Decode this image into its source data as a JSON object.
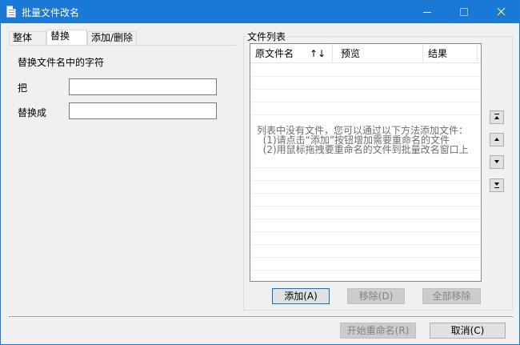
{
  "window": {
    "title": "批量文件改名",
    "minimize": "—",
    "maximize": "☐",
    "close": "✕"
  },
  "tabs": [
    {
      "label": "整体",
      "active": false
    },
    {
      "label": "替换",
      "active": true
    },
    {
      "label": "添加/删除",
      "active": false
    }
  ],
  "replace": {
    "section_label": "替换文件名中的字符",
    "from_label": "把",
    "from_value": "",
    "to_label": "替换成",
    "to_value": ""
  },
  "file_list": {
    "group_title": "文件列表",
    "columns": [
      {
        "label": "原文件名"
      },
      {
        "label": "预览"
      },
      {
        "label": "结果"
      }
    ],
    "sort_label": "↑↓",
    "empty_lines": [
      "列表中没有文件，您可以通过以下方法添加文件：",
      "  (1)请点击“添加”按钮增加需要重命名的文件",
      "  (2)用鼠标拖拽要重命名的文件到批量改名窗口上"
    ]
  },
  "list_buttons": {
    "add": "添加(A)",
    "remove": "移除(D)",
    "remove_all": "全部移除"
  },
  "footer": {
    "start": "开始重命名(R)",
    "cancel": "取消(C)"
  },
  "colors": {
    "titlebar": "#1a78d7",
    "window_bg": "#f0f0f0"
  }
}
